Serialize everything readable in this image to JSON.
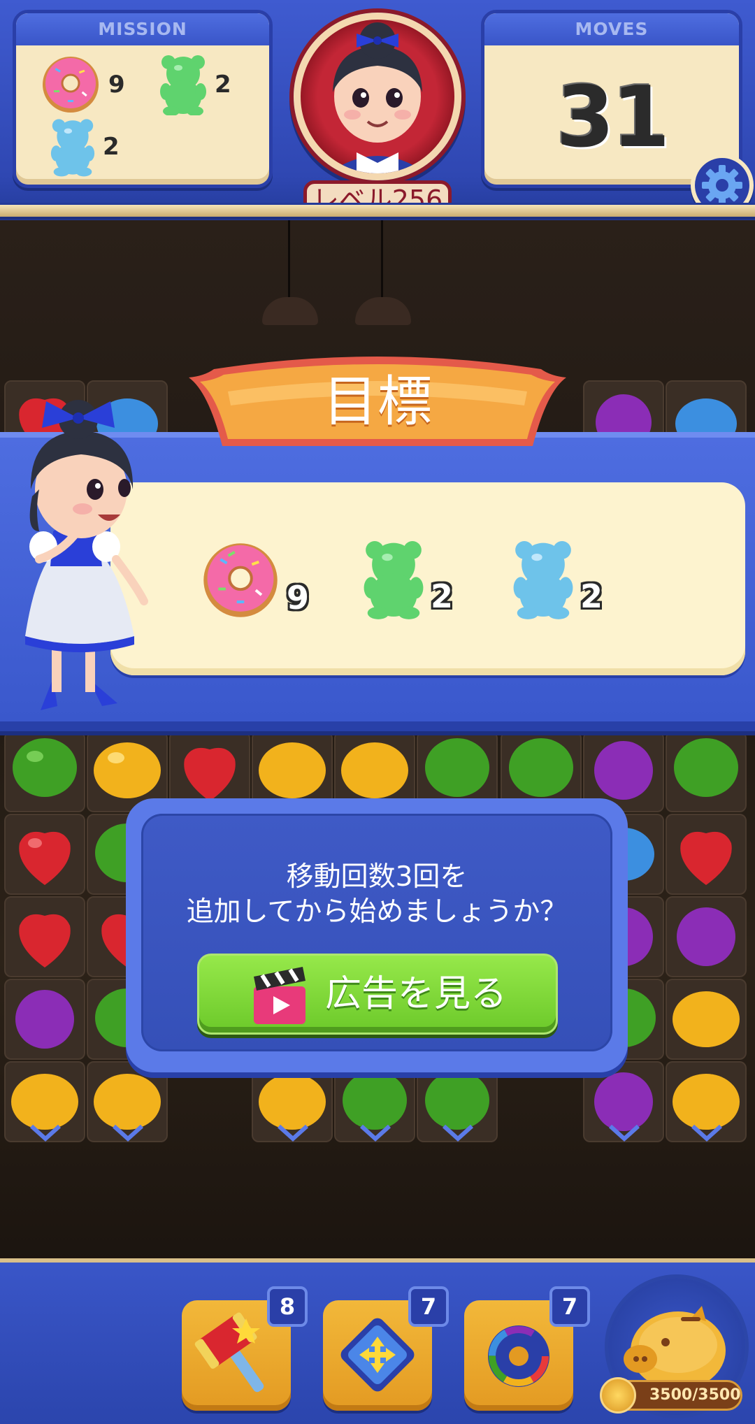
{
  "hud": {
    "mission_title": "MISSION",
    "moves_title": "MOVES",
    "moves_value": "31",
    "level_label": "レベル256",
    "mission_items": [
      {
        "icon": "donut-icon",
        "count": "9"
      },
      {
        "icon": "green-gummy-bear-icon",
        "count": "2"
      },
      {
        "icon": "blue-gummy-bear-icon",
        "count": "2"
      }
    ],
    "settings_icon": "gear-icon"
  },
  "goal": {
    "title": "目標",
    "items": [
      {
        "icon": "donut-icon",
        "count": "9"
      },
      {
        "icon": "green-gummy-bear-icon",
        "count": "2"
      },
      {
        "icon": "blue-gummy-bear-icon",
        "count": "2"
      }
    ]
  },
  "dialog": {
    "line1": "移動回数3回を",
    "line2": "追加してから始めましょうか？",
    "button_label": "広告を見る",
    "button_icon": "clapperboard-play-icon"
  },
  "boosters": [
    {
      "icon": "hammer-icon",
      "count": "8"
    },
    {
      "icon": "swap-arrows-icon",
      "count": "7"
    },
    {
      "icon": "rainbow-donut-icon",
      "count": "7"
    }
  ],
  "piggy_bank": {
    "icon": "piggy-bank-icon",
    "coins": "3500/3500"
  },
  "colors": {
    "hud_blue": "#3f5bd0",
    "panel_cream": "#f7e8c2",
    "goal_orange": "#f2a63a",
    "button_green": "#7ed53a",
    "accent_red": "#8b1a2b"
  }
}
